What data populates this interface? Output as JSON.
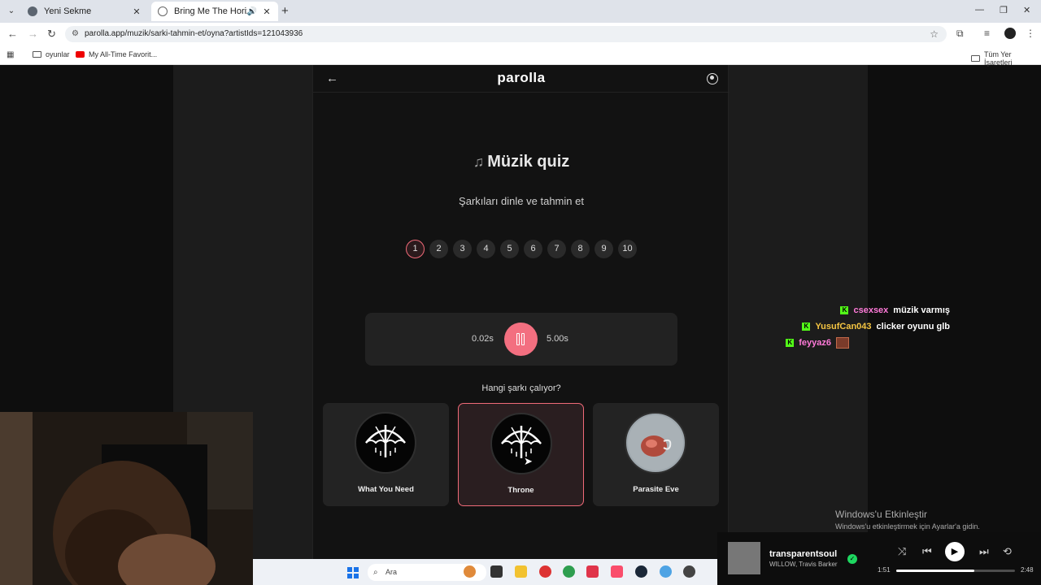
{
  "browser": {
    "tabs": [
      {
        "title": "Yeni Sekme"
      },
      {
        "title": "Bring Me The Horizon şarkı"
      }
    ],
    "url": "parolla.app/muzik/sarki-tahmin-et/oyna?artistIds=121043936",
    "bookmarks": [
      {
        "label": "oyunlar"
      },
      {
        "label": "My All-Time Favorit..."
      }
    ],
    "all_bookmarks_label": "Tüm Yer İşaretleri"
  },
  "app": {
    "logo": "parolla",
    "title": "Müzik quiz",
    "subtitle": "Şarkıları dinle ve tahmin et",
    "steps": [
      "1",
      "2",
      "3",
      "4",
      "5",
      "6",
      "7",
      "8",
      "9",
      "10"
    ],
    "current_step": 1,
    "player": {
      "elapsed": "0.02s",
      "duration": "5.00s"
    },
    "question": "Hangi şarkı çalıyor?",
    "options": [
      {
        "label": "What You Need",
        "selected": false
      },
      {
        "label": "Throne",
        "selected": true
      },
      {
        "label": "Parasite Eve",
        "selected": false
      }
    ]
  },
  "chat": [
    {
      "user": "csexsex",
      "message": "müzik varmış",
      "color": "#ff7ad9"
    },
    {
      "user": "YusufCan043",
      "message": "clicker oyunu glb",
      "color": "#f5c542"
    },
    {
      "user": "feyyaz6",
      "message": "",
      "color": "#ff7ad9"
    }
  ],
  "windows_activation": {
    "line1": "Windows'u Etkinleştir",
    "line2": "Windows'u etkinleştirmek için Ayarlar'a gidin."
  },
  "taskbar": {
    "search_placeholder": "Ara"
  },
  "spotify": {
    "title": "transparentsoul",
    "artist": "WILLOW, Travis Barker",
    "elapsed": "1:51",
    "total": "2:48",
    "progress": 0.66
  },
  "colors": {
    "accent": "#f36f80",
    "kick_green": "#53fc18",
    "spotify_green": "#1ed760"
  }
}
